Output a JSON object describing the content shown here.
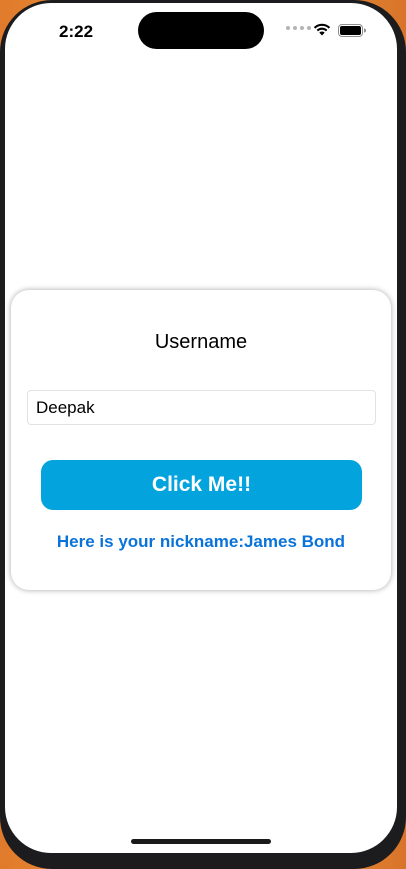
{
  "status_bar": {
    "time": "2:22"
  },
  "card": {
    "title": "Username",
    "input_value": "Deepak",
    "button_label": "Click Me!!",
    "nickname_text": "Here is your nickname:James Bond"
  },
  "colors": {
    "button_bg": "#03a3dd",
    "nickname_color": "#0a73d9"
  },
  "icons": [
    "wifi-icon",
    "battery-icon",
    "signal-dots-icon"
  ]
}
